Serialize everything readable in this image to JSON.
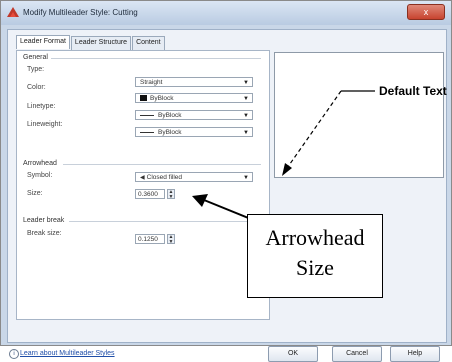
{
  "window": {
    "title": "Modify Multileader Style: Cutting",
    "close_glyph": "x"
  },
  "tabs": [
    "Leader Format",
    "Leader Structure",
    "Content"
  ],
  "general": {
    "heading": "General",
    "type_label": "Type:",
    "type_value": "Straight",
    "color_label": "Color:",
    "color_value": "ByBlock",
    "linetype_label": "Linetype:",
    "linetype_value": "ByBlock",
    "lineweight_label": "Lineweight:",
    "lineweight_value": "ByBlock"
  },
  "arrowhead": {
    "heading": "Arrowhead",
    "symbol_label": "Symbol:",
    "symbol_value": "Closed filled",
    "size_label": "Size:",
    "size_value": "0.3600"
  },
  "leader_break": {
    "heading": "Leader break",
    "break_size_label": "Break size:",
    "break_size_value": "0.1250"
  },
  "preview": {
    "text": "Default Text"
  },
  "callout": {
    "line1": "Arrowhead",
    "line2": "Size"
  },
  "footer": {
    "learn_link": "Learn about Multileader Styles",
    "info_glyph": "i",
    "ok_label": "OK",
    "cancel_label": "Cancel",
    "help_label": "Help"
  },
  "icons": {
    "app": "autocad-icon",
    "info": "info-icon",
    "dropdown": "chevron-down-icon",
    "spin": "spinner-arrows-icon"
  },
  "colors": {
    "title_gradient_top": "#dbe6f4",
    "close_red": "#c7442f",
    "link_blue": "#1f4ea8"
  }
}
